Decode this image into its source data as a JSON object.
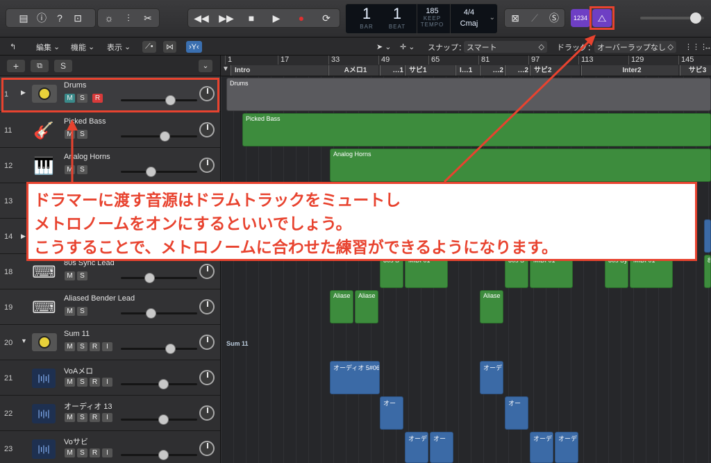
{
  "toolbar": {
    "left_icons": [
      "library-icon",
      "info-icon",
      "help-icon",
      "inbox-icon",
      "smart-controls-icon",
      "mixer-icon",
      "scissors-icon"
    ],
    "transport_icons": [
      "rewind-icon",
      "fast-forward-icon",
      "stop-icon",
      "play-icon",
      "record-icon",
      "cycle-icon"
    ],
    "lcd": {
      "bar": "1",
      "bar_label": "BAR",
      "beat": "1",
      "beat_label": "BEAT",
      "tempo": "185",
      "tempo_mode": "KEEP",
      "tempo_label": "TEMPO",
      "signature": "4/4",
      "key": "Cmaj"
    },
    "count_in": "1234",
    "metronome_icon": "metronome-icon"
  },
  "menu": {
    "edit": "編集",
    "function": "機能",
    "view": "表示",
    "snap_label": "スナップ：",
    "snap_value": "スマート",
    "drag_label": "ドラッグ：",
    "drag_value": "オーバーラップなし"
  },
  "header_buttons": {
    "add": "+",
    "folder": "⧉",
    "s": "S"
  },
  "ruler": {
    "bars": [
      "1",
      "17",
      "33",
      "49",
      "65",
      "81",
      "97",
      "113",
      "129",
      "145"
    ],
    "markers": [
      {
        "label": "Intro"
      },
      {
        "label": "Aメロ1"
      },
      {
        "label": "…1"
      },
      {
        "label": "サビ1"
      },
      {
        "label": "I…1"
      },
      {
        "label": "…2"
      },
      {
        "label": "…2"
      },
      {
        "label": "サビ2"
      },
      {
        "label": "Inter2"
      },
      {
        "label": "サビ3"
      }
    ]
  },
  "tracks": [
    {
      "num": "1",
      "name": "Drums",
      "m": "M",
      "s": "S",
      "r": "R"
    },
    {
      "num": "11",
      "name": "Picked Bass",
      "m": "M",
      "s": "S"
    },
    {
      "num": "12",
      "name": "Analog Horns",
      "m": "M",
      "s": "S"
    },
    {
      "num": "13",
      "name": ""
    },
    {
      "num": "14",
      "name": ""
    },
    {
      "num": "18",
      "name": "80s Sync Lead",
      "m": "M",
      "s": "S"
    },
    {
      "num": "19",
      "name": "Aliased Bender Lead",
      "m": "M",
      "s": "S"
    },
    {
      "num": "20",
      "name": "Sum 11",
      "m": "M",
      "s": "S",
      "r": "R",
      "i": "I"
    },
    {
      "num": "21",
      "name": "VoAメロ",
      "m": "M",
      "s": "S",
      "r": "R",
      "i": "I"
    },
    {
      "num": "22",
      "name": "オーディオ 13",
      "m": "M",
      "s": "S",
      "r": "R",
      "i": "I"
    },
    {
      "num": "23",
      "name": "Voサビ",
      "m": "M",
      "s": "S",
      "r": "R",
      "i": "I"
    }
  ],
  "regions": {
    "drums": "Drums",
    "bass": "Picked Bass",
    "horns": "Analog Horns",
    "sync1": "80s S",
    "sync2": "MIDI 01",
    "sync3": "80s S",
    "sync4": "MIDI 01",
    "sync5": "80s Sy",
    "sync6": "MIDI 01",
    "sync7": "80",
    "alias1": "Aliase",
    "alias2": "Aliase",
    "alias3": "Aliase",
    "sum": "Sum 11",
    "audio1": "オーディオ 5#06",
    "audio2": "オーデ",
    "audio3": "オー",
    "audio4": "オー",
    "audio5": "オーデ",
    "audio6": "オー",
    "audio7": "オーデ",
    "audio8": "オーデ"
  },
  "annotation": {
    "line1": "ドラマーに渡す音源はドラムトラックをミュートし",
    "line2": "メトロノームをオンにするといいでしょう。",
    "line3": "こうすることで、メトロノームに合わせた練習ができるようになります。"
  },
  "colors": {
    "accent": "#e8432f",
    "midi": "#3d8c3d",
    "audio": "#3b6aa6",
    "count_in": "#6e3fc4"
  }
}
